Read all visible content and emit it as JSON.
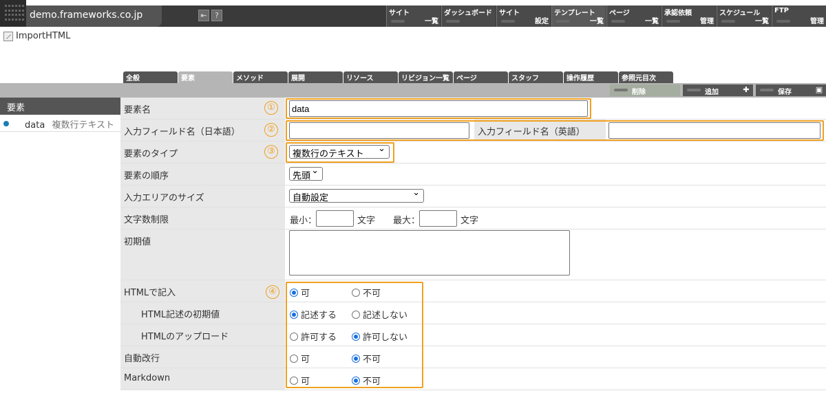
{
  "topbar": {
    "site_name": "demo.frameworks.co.jp",
    "nav": [
      {
        "top": "サイト",
        "bottom": "一覧"
      },
      {
        "top": "ダッシュボード",
        "bottom": ""
      },
      {
        "top": "サイト",
        "bottom": "設定"
      },
      {
        "top": "テンプレート",
        "bottom": "一覧"
      },
      {
        "top": "ページ",
        "bottom": "一覧"
      },
      {
        "top": "承認依頼",
        "bottom": "管理"
      },
      {
        "top": "スケジュール",
        "bottom": "一覧"
      },
      {
        "top": "FTP",
        "bottom": "管理"
      }
    ]
  },
  "breadcrumb": {
    "label": "ImportHTML"
  },
  "tabs": [
    "全般",
    "要素",
    "メソッド",
    "展開",
    "リソース",
    "リビジョン一覧",
    "ページ",
    "スタッフ",
    "操作履歴",
    "参照元目次"
  ],
  "actions": {
    "delete": "削除",
    "add": "追加",
    "save": "保存"
  },
  "sidebar": {
    "heading": "要素",
    "item_name": "data",
    "item_type": "複数行テキスト"
  },
  "form": {
    "element_name_label": "要素名",
    "element_name_value": "data",
    "field_name_ja_label": "入力フィールド名（日本語）",
    "field_name_ja_value": "",
    "field_name_en_label": "入力フィールド名（英語）",
    "field_name_en_value": "",
    "element_type_label": "要素のタイプ",
    "element_type_value": "複数行のテキスト",
    "element_order_label": "要素の順序",
    "element_order_value": "先頭",
    "area_size_label": "入力エリアのサイズ",
    "area_size_value": "自動設定",
    "char_limit_label": "文字数制限",
    "min_label": "最小：",
    "max_label": "最大：",
    "char_unit": "文字",
    "initial_value_label": "初期値",
    "html_input_label": "HTMLで記入",
    "html_input_yes": "可",
    "html_input_no": "不可",
    "html_initial_label": "HTML記述の初期値",
    "html_initial_yes": "記述する",
    "html_initial_no": "記述しない",
    "html_upload_label": "HTMLのアップロード",
    "html_upload_yes": "許可する",
    "html_upload_no": "許可しない",
    "auto_break_label": "自動改行",
    "auto_break_yes": "可",
    "auto_break_no": "不可",
    "markdown_label": "Markdown",
    "markdown_yes": "可",
    "markdown_no": "不可"
  },
  "annotations": [
    "①",
    "②",
    "③",
    "④"
  ],
  "colors": {
    "highlight": "#f0a020",
    "radio_checked": "#1a6fe0",
    "topbar": "#3a3a3a"
  }
}
